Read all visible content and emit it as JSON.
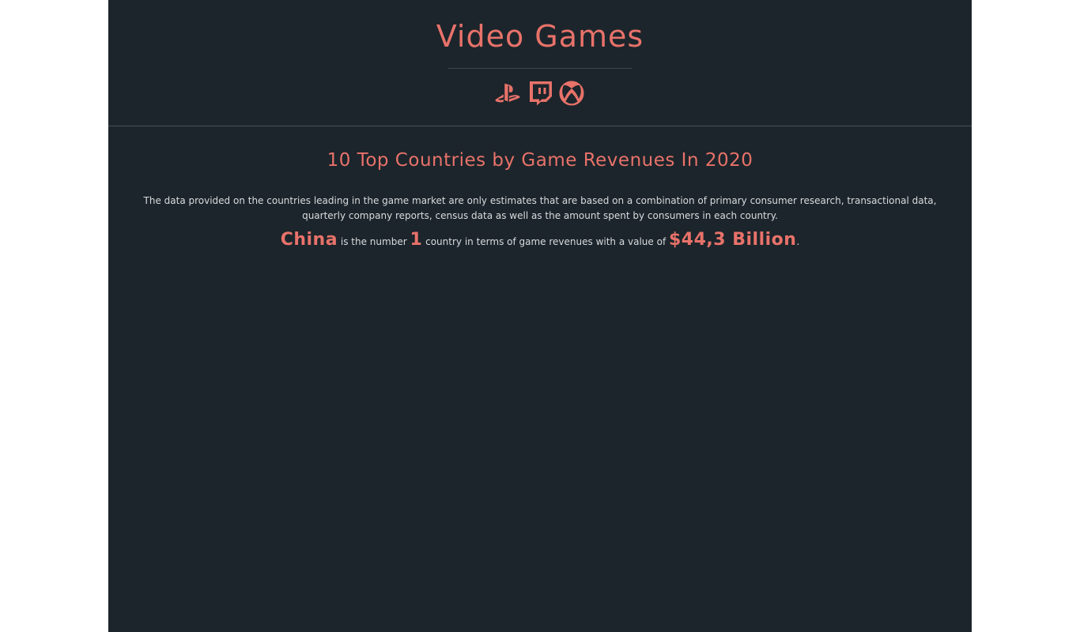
{
  "header": {
    "title": "Video Games",
    "icons": [
      "playstation-icon",
      "twitch-icon",
      "xbox-icon"
    ]
  },
  "main": {
    "section_title": "10 Top Countries by Game Revenues In 2020",
    "description": "The data provided on the countries leading in the game market are only estimates that are based on a combination of primary consumer research, transactional data, quarterly company reports, census data as well as the amount spent by consumers in each country.",
    "fact": {
      "country": "China",
      "text_1": "is the number",
      "rank": "1",
      "text_2": "country in terms of game revenues with a value of",
      "value": "$44,3 Billion",
      "suffix": "."
    }
  },
  "colors": {
    "accent": "#e8726a",
    "background": "#1c252b",
    "text": "#d8dcdf"
  }
}
